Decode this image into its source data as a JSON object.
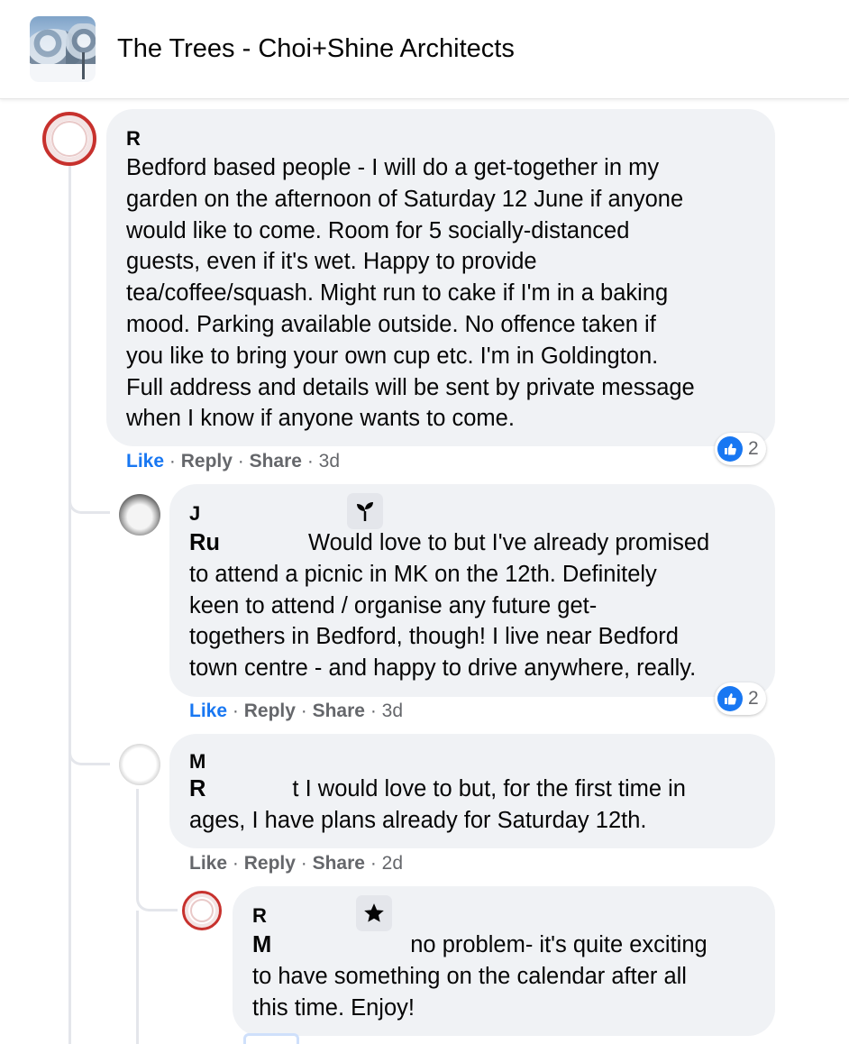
{
  "header": {
    "title": "The Trees - Choi+Shine Architects"
  },
  "comments": [
    {
      "author": "R",
      "lines": [
        "Bedford based people - I will do a get-together in my",
        "garden on the afternoon of Saturday 12 June if anyone",
        "would like to come. Room for 5 socially-distanced",
        "guests, even if it's wet. Happy to provide",
        "tea/coffee/squash. Might run to cake if I'm in a baking",
        "mood. Parking available outside. No offence taken if",
        "you like to bring your own cup etc. I'm in Goldington.",
        "Full address and details will be sent by private message",
        "when I know if anyone wants to come."
      ],
      "actions": {
        "like": "Like",
        "reply": "Reply",
        "share": "Share",
        "sep": "·",
        "time": "3d"
      },
      "reactions": {
        "icon": "like-icon",
        "count": "2"
      }
    },
    {
      "author": "J",
      "badge_icon": "sprout-icon",
      "mention": "Ru",
      "lines": [
        "Would love to but I've already promised",
        "to attend a picnic in MK on the 12th. Definitely",
        "keen to attend / organise any future get-",
        "togethers in Bedford, though! I live near Bedford",
        "town centre - and happy to drive anywhere, really."
      ],
      "actions": {
        "like": "Like",
        "reply": "Reply",
        "share": "Share",
        "sep": "·",
        "time": "3d"
      },
      "reactions": {
        "icon": "like-icon",
        "count": "2"
      }
    },
    {
      "author": "M",
      "mention": "R",
      "mention_tail": "t",
      "lines": [
        "I would love to but, for the first time in",
        "ages, I have plans already for Saturday 12th."
      ],
      "actions": {
        "like": "Like",
        "reply": "Reply",
        "share": "Share",
        "sep": "·",
        "time": "2d"
      }
    },
    {
      "author": "R",
      "badge_icon": "star-icon",
      "mention": "M",
      "lines": [
        "no problem- it's quite exciting",
        "to have something on the calendar after all",
        "this time. Enjoy!"
      ]
    }
  ],
  "colors": {
    "accent": "#1877f2",
    "bubble": "#f0f2f5",
    "meta": "#65676b"
  }
}
